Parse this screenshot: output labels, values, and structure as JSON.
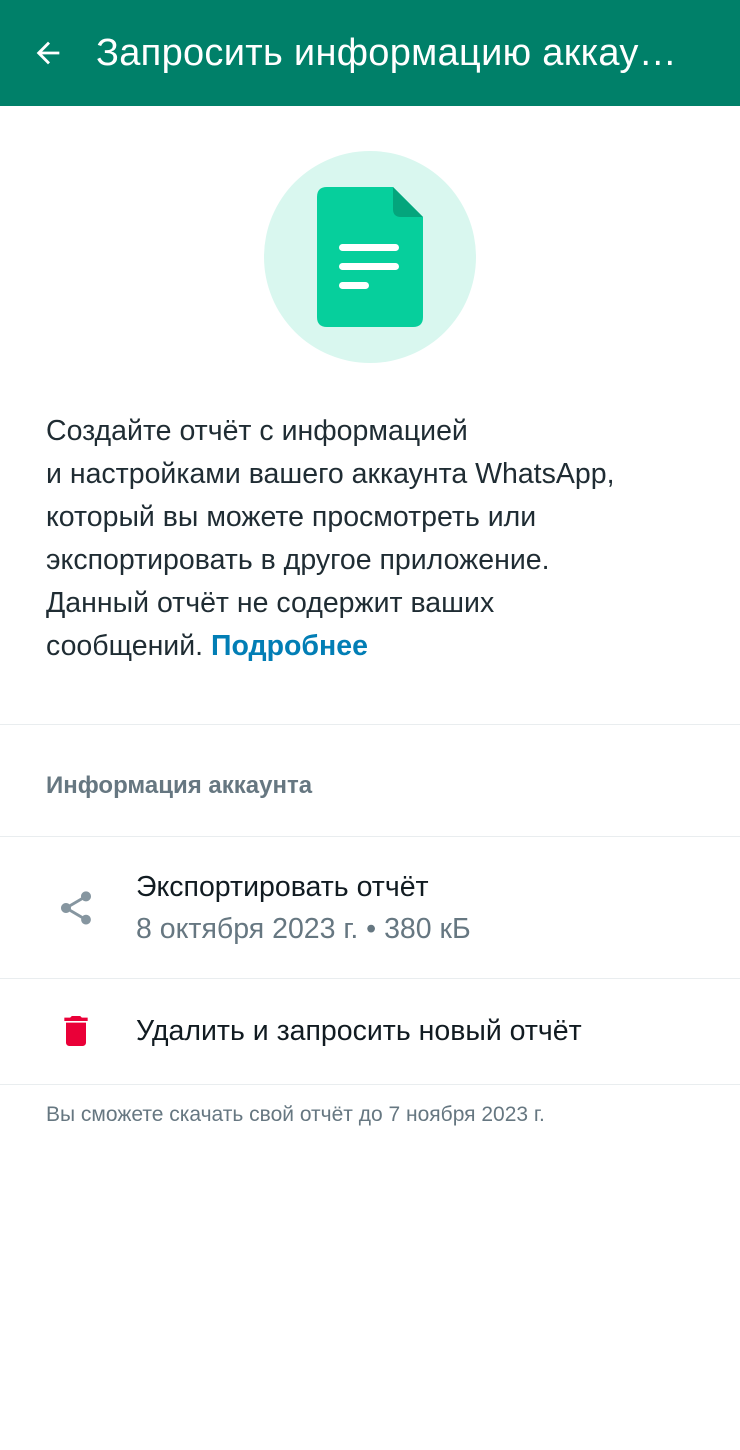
{
  "app_bar": {
    "back_icon": "arrow-back-icon",
    "title": "Запросить информацию аккау…",
    "color": "#008069"
  },
  "hero": {
    "icon": "document-icon",
    "circle_color": "#d9f7ef",
    "icon_color": "#06cf9c"
  },
  "description": {
    "line1": "Создайте отчёт с информацией",
    "line2": "и настройками вашего аккаунта WhatsApp,",
    "line3": "который вы можете просмотреть или",
    "line4": "экспортировать в другое приложение.",
    "line5": "Данный отчёт не содержит ваших",
    "line6": "сообщений.",
    "learn_more": "Подробнее",
    "link_color": "#027eb5"
  },
  "section": {
    "title": "Информация аккаунта"
  },
  "export_row": {
    "icon": "share-icon",
    "title": "Экспортировать отчёт",
    "subtitle": "8 октября 2023 г. • 380 кБ"
  },
  "delete_row": {
    "icon": "trash-icon",
    "title": "Удалить и запросить новый отчёт",
    "icon_color": "#ea0038"
  },
  "footnote": "Вы сможете скачать свой отчёт до 7 ноября 2023 г."
}
